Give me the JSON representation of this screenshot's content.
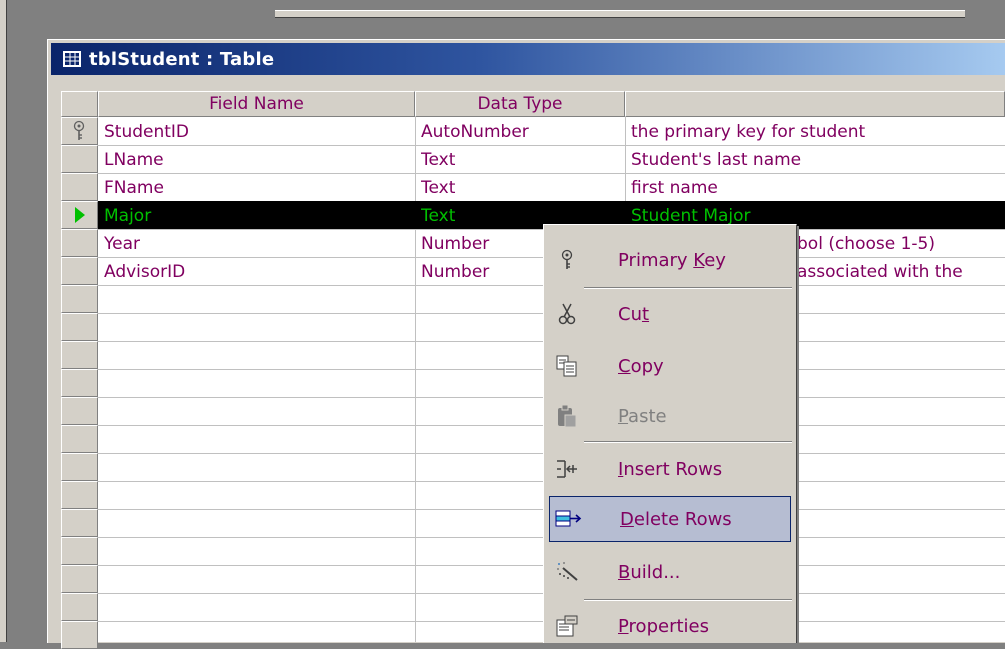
{
  "window": {
    "title": "tblStudent : Table"
  },
  "columns": {
    "field_name": "Field Name",
    "data_type": "Data Type",
    "description": ""
  },
  "rows": [
    {
      "field": "StudentID",
      "type": "AutoNumber",
      "desc": "the primary key for student"
    },
    {
      "field": "LName",
      "type": "Text",
      "desc": "Student's last name"
    },
    {
      "field": "FName",
      "type": "Text",
      "desc": "first name"
    },
    {
      "field": "Major",
      "type": "Text",
      "desc": "Student Major"
    },
    {
      "field": "Year",
      "type": "Number",
      "desc": "bol (choose 1-5)"
    },
    {
      "field": "AdvisorID",
      "type": "Number",
      "desc": "associated  with the"
    }
  ],
  "context_menu": {
    "primary_key": {
      "pre": "Primary ",
      "key": "K",
      "post": "ey"
    },
    "cut": {
      "pre": "Cu",
      "key": "t",
      "post": ""
    },
    "copy": {
      "pre": "",
      "key": "C",
      "post": "opy"
    },
    "paste": {
      "pre": "",
      "key": "P",
      "post": "aste"
    },
    "insert_rows": {
      "pre": "",
      "key": "I",
      "post": "nsert Rows"
    },
    "delete_rows": {
      "pre": "",
      "key": "D",
      "post": "elete Rows"
    },
    "build": {
      "pre": "",
      "key": "B",
      "post": "uild..."
    },
    "properties": {
      "pre": "",
      "key": "P",
      "post": "roperties"
    }
  },
  "icons": {
    "table": "table-icon",
    "key": "key-icon",
    "cut": "scissors-icon",
    "copy": "copy-icon",
    "paste": "paste-icon",
    "insert": "insert-rows-icon",
    "delete": "delete-rows-icon",
    "build": "wand-icon",
    "properties": "properties-icon"
  },
  "colors": {
    "text": "#800060",
    "selected_text": "#00c000",
    "title_start": "#0a246a",
    "title_end": "#a6caf0",
    "highlight": "#b6bdd2"
  }
}
